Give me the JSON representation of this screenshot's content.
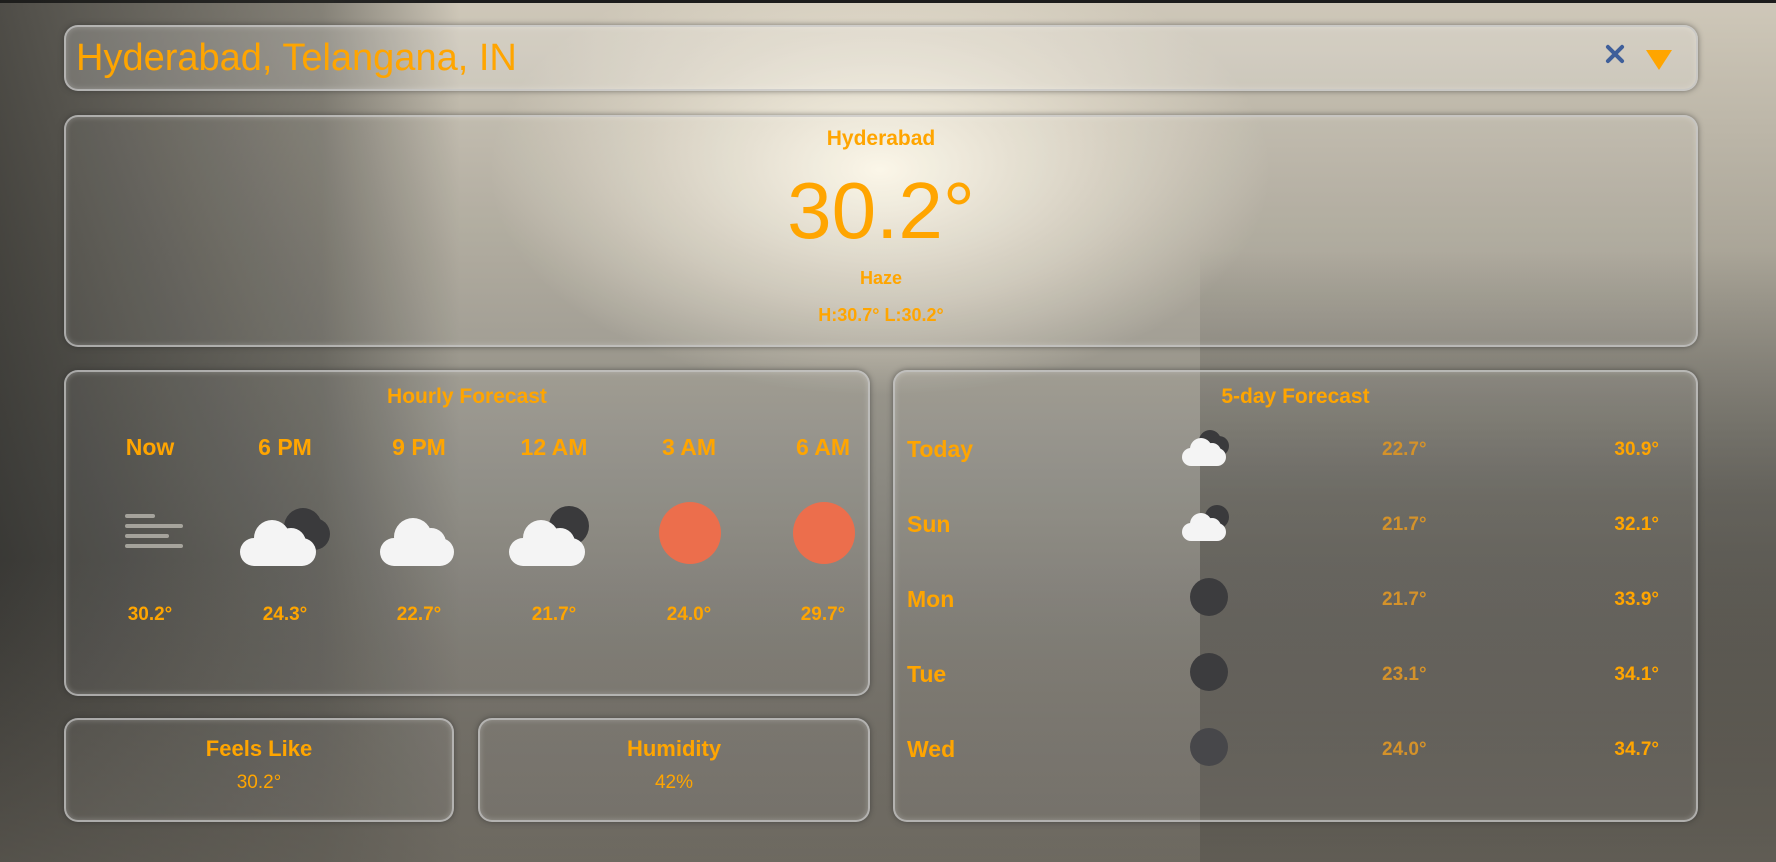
{
  "search": {
    "value": "Hyderabad, Telangana, IN"
  },
  "current": {
    "city": "Hyderabad",
    "temp": "30.2°",
    "condition": "Haze",
    "high_low": "H:30.7° L:30.2°"
  },
  "hourly": {
    "title": "Hourly Forecast",
    "items": [
      {
        "time": "Now",
        "icon": "haze-icon",
        "temp": "30.2°"
      },
      {
        "time": "6 PM",
        "icon": "cloudy-night-icon",
        "temp": "24.3°"
      },
      {
        "time": "9 PM",
        "icon": "cloud-icon",
        "temp": "22.7°"
      },
      {
        "time": "12 AM",
        "icon": "cloudy-night-icon",
        "temp": "21.7°"
      },
      {
        "time": "3 AM",
        "icon": "sun-icon",
        "temp": "24.0°"
      },
      {
        "time": "6 AM",
        "icon": "sun-icon",
        "temp": "29.7°"
      }
    ]
  },
  "daily": {
    "title": "5-day Forecast",
    "items": [
      {
        "day": "Today",
        "icon": "cloudy-night-icon",
        "low": "22.7°",
        "high": "30.9°"
      },
      {
        "day": "Sun",
        "icon": "cloudy-night-icon",
        "low": "21.7°",
        "high": "32.1°"
      },
      {
        "day": "Mon",
        "icon": "moon-icon",
        "low": "21.7°",
        "high": "33.9°"
      },
      {
        "day": "Tue",
        "icon": "moon-icon",
        "low": "23.1°",
        "high": "34.1°"
      },
      {
        "day": "Wed",
        "icon": "moon-icon",
        "low": "24.0°",
        "high": "34.7°"
      }
    ]
  },
  "feels_like": {
    "label": "Feels Like",
    "value": "30.2°"
  },
  "humidity": {
    "label": "Humidity",
    "value": "42%"
  },
  "colors": {
    "accent": "#ffa500",
    "clear_icon": "#3f5f9a",
    "sun": "#ec6e4c",
    "moon": "#3c3c3e"
  }
}
